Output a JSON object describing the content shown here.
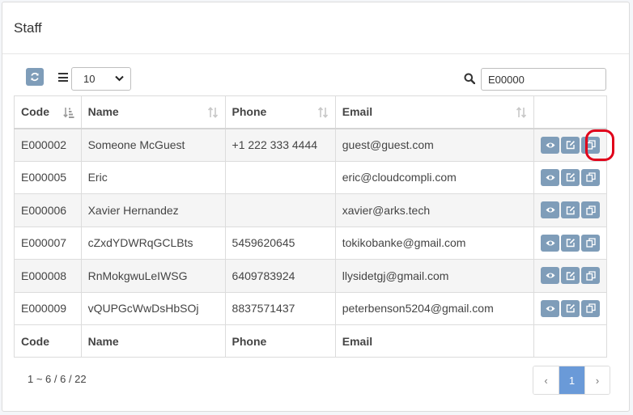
{
  "panel": {
    "title": "Staff"
  },
  "toolbar": {
    "page_size": "10",
    "search_value": "E00000"
  },
  "table": {
    "headers": {
      "code": "Code",
      "name": "Name",
      "phone": "Phone",
      "email": "Email"
    },
    "rows": [
      {
        "code": "E000002",
        "name": "Someone McGuest",
        "phone": "+1 222 333 4444",
        "email": "guest@guest.com"
      },
      {
        "code": "E000005",
        "name": "Eric",
        "phone": "",
        "email": "eric@cloudcompli.com"
      },
      {
        "code": "E000006",
        "name": "Xavier Hernandez",
        "phone": "",
        "email": "xavier@arks.tech"
      },
      {
        "code": "E000007",
        "name": "cZxdYDWRqGCLBts",
        "phone": "5459620645",
        "email": "tokikobanke@gmail.com"
      },
      {
        "code": "E000008",
        "name": "RnMokgwuLeIWSG",
        "phone": "6409783924",
        "email": "llysidetgj@gmail.com"
      },
      {
        "code": "E000009",
        "name": "vQUPGcWwDsHbSOj",
        "phone": "8837571437",
        "email": "peterbenson5204@gmail.com"
      }
    ]
  },
  "footer": {
    "summary": "1 ~ 6 / 6 / 22",
    "prev": "‹",
    "current_page": "1",
    "next": "›"
  },
  "colors": {
    "button": "#7f9db9",
    "active_page": "#6a9ad8",
    "highlight": "#e0001a"
  }
}
